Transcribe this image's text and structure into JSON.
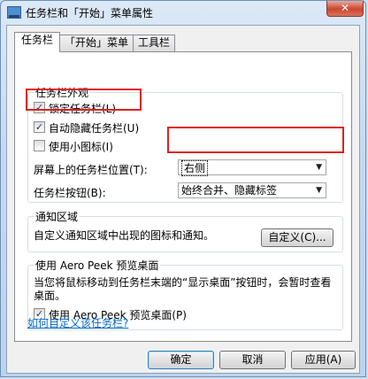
{
  "window": {
    "title": "任务栏和「开始」菜单属性",
    "close_glyph": "✕"
  },
  "tabs": [
    {
      "label": "任务栏"
    },
    {
      "label": "「开始」菜单"
    },
    {
      "label": "工具栏"
    }
  ],
  "appearance": {
    "legend": "任务栏外观",
    "lock_label": "锁定任务栏(L)",
    "lock_checked": true,
    "autohide_label": "自动隐藏任务栏(U)",
    "autohide_checked": true,
    "small_icons_label": "使用小图标(I)",
    "small_icons_checked": false,
    "position_label": "屏幕上的任务栏位置(T):",
    "position_value": "右侧",
    "buttons_label": "任务栏按钮(B):",
    "buttons_value": "始终合并、隐藏标签"
  },
  "notification": {
    "legend": "通知区域",
    "text": "自定义通知区域中出现的图标和通知。",
    "customize_button": "自定义(C)..."
  },
  "aero_peek": {
    "legend": "使用 Aero Peek 预览桌面",
    "description": "当您将鼠标移动到任务栏末端的“显示桌面”按钮时，会暂时查看桌面。",
    "checkbox_label": "使用 Aero Peek 预览桌面(P)",
    "checked": true
  },
  "help_link": "如何自定义该任务栏?",
  "footer": {
    "ok": "确定",
    "cancel": "取消",
    "apply": "应用(A)"
  },
  "annotation_color": "#e02020"
}
